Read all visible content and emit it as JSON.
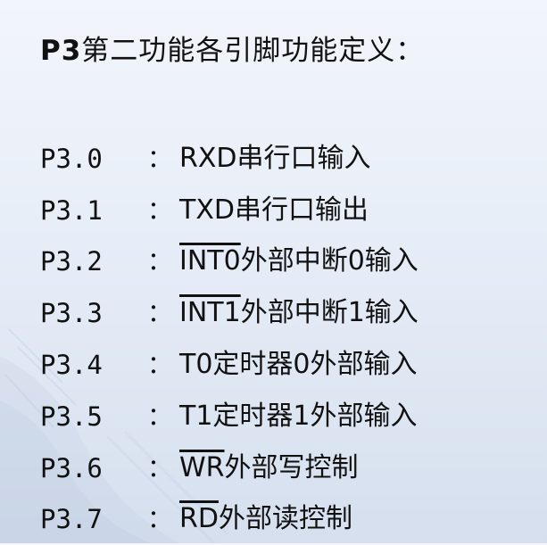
{
  "title": {
    "prefix": "P3",
    "rest": "第二功能各引脚功能定义："
  },
  "pins": [
    {
      "id": "P3.0",
      "sep": "：",
      "signal": "RXD",
      "overline": false,
      "desc": "串行口输入"
    },
    {
      "id": "P3.1",
      "sep": "：",
      "signal": "TXD",
      "overline": false,
      "desc": "串行口输出"
    },
    {
      "id": "P3.2",
      "sep": "：",
      "signal": "INT0",
      "overline": true,
      "desc": "外部中断0输入"
    },
    {
      "id": "P3.3",
      "sep": "：",
      "signal": "INT1",
      "overline": true,
      "desc": "外部中断1输入"
    },
    {
      "id": "P3.4",
      "sep": "：",
      "signal": "T0",
      "overline": false,
      "desc": "定时器0外部输入"
    },
    {
      "id": "P3.5",
      "sep": "：",
      "signal": "T1",
      "overline": false,
      "desc": "定时器1外部输入"
    },
    {
      "id": "P3.6",
      "sep": "：",
      "signal": "WR",
      "overline": true,
      "desc": "外部写控制"
    },
    {
      "id": "P3.7",
      "sep": "：",
      "signal": "RD",
      "overline": true,
      "desc": "外部读控制"
    }
  ]
}
